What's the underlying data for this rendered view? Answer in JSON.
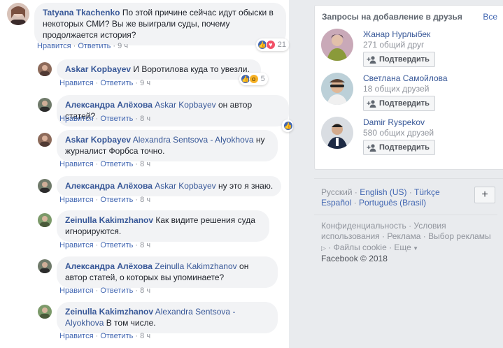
{
  "comments": [
    {
      "author": "Tatyana Tkachenko",
      "mention": "",
      "text": "По этой причине сейчас идут обыски в некоторых СМИ? Вы же выиграли суды, почему продолжается история?",
      "like": "Нравится",
      "reply": "Ответить",
      "time": "9 ч",
      "react_count": "21",
      "reactions": [
        "like-icon",
        "love-icon"
      ]
    },
    {
      "author": "Askar Kopbayev",
      "mention": "",
      "text": "И Воротилова куда то увезли.",
      "like": "Нравится",
      "reply": "Ответить",
      "time": "9 ч",
      "react_count": "5",
      "reactions": [
        "like-icon",
        "wow-icon"
      ]
    },
    {
      "author": "Александра Алёхова",
      "mention": "Askar Kopbayev",
      "text": "он автор статей?",
      "like": "Нравится",
      "reply": "Ответить",
      "time": "8 ч",
      "react_count": "",
      "reactions": [
        "like-icon"
      ]
    },
    {
      "author": "Askar Kopbayev",
      "mention": "Alexandra Sentsova - Alyokhova",
      "text": "ну журналист Форбса точно.",
      "like": "Нравится",
      "reply": "Ответить",
      "time": "8 ч"
    },
    {
      "author": "Александра Алёхова",
      "mention": "Askar Kopbayev",
      "text": "ну это я знаю.",
      "like": "Нравится",
      "reply": "Ответить",
      "time": "8 ч"
    },
    {
      "author": "Zeinulla Kakimzhanov",
      "mention": "",
      "text": "Как видите решения суда игнорируются.",
      "like": "Нравится",
      "reply": "Ответить",
      "time": "8 ч"
    },
    {
      "author": "Александра Алёхова",
      "mention": "Zeinulla Kakimzhanov",
      "text": "он автор статей, о которых вы упоминаете?",
      "like": "Нравится",
      "reply": "Ответить",
      "time": "8 ч"
    },
    {
      "author": "Zeinulla Kakimzhanov",
      "mention": "Alexandra Sentsova - Alyokhova",
      "text": "В том числе.",
      "like": "Нравится",
      "reply": "Ответить",
      "time": "8 ч"
    }
  ],
  "friend_requests": {
    "title": "Запросы на добавление в друзья",
    "see_all": "Все",
    "items": [
      {
        "name": "Жанар Нурлыбек",
        "mutual": "271 общий друг",
        "button": "Подтвердить"
      },
      {
        "name": "Светлана Самойлова",
        "mutual": "18 общих друзей",
        "button": "Подтвердить"
      },
      {
        "name": "Damir Ryspekov",
        "mutual": "580 общих друзей",
        "button": "Подтвердить"
      }
    ]
  },
  "languages": {
    "current": "Русский",
    "sep": " · ",
    "links": [
      "English (US)",
      "Türkçe",
      "Español",
      "Português (Brasil)"
    ],
    "add": "+"
  },
  "footer": {
    "links": [
      "Конфиденциальность",
      "Условия использования",
      "Реклама",
      "Выбор рекламы",
      "Файлы cookie",
      "Еще"
    ],
    "copyright": "Facebook © 2018"
  },
  "colors": {
    "link": "#385898",
    "accent": "#4267b2",
    "bubble": "#f2f3f5",
    "page_bg": "#e9ebee"
  }
}
